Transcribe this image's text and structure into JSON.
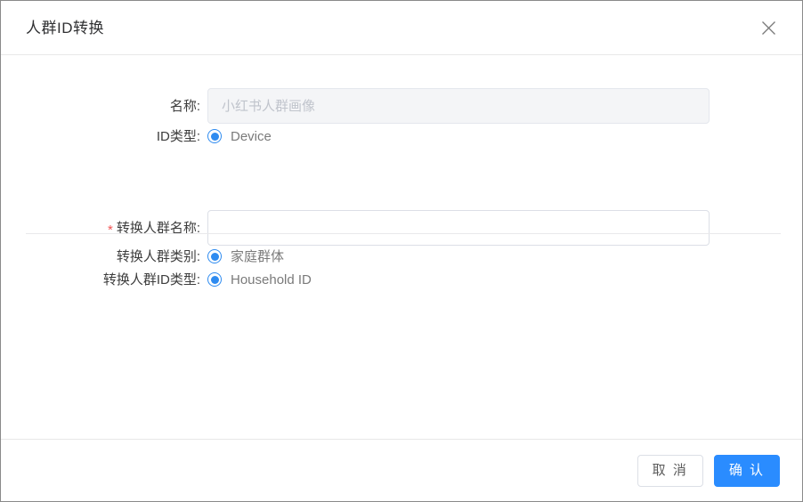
{
  "dialog": {
    "title": "人群ID转换",
    "close_icon": "close-icon"
  },
  "form": {
    "name_row": {
      "label": "名称:",
      "input_value": "",
      "input_placeholder": "小红书人群画像",
      "disabled": true
    },
    "id_type_row": {
      "label": "ID类型:",
      "options": [
        {
          "label": "Device",
          "selected": true
        }
      ]
    },
    "target_name_row": {
      "required_mark": "*",
      "label": "转换人群名称:",
      "input_value": "",
      "input_placeholder": ""
    },
    "target_category_row": {
      "label": "转换人群类别:",
      "options": [
        {
          "label": "家庭群体",
          "selected": true
        }
      ]
    },
    "target_id_type_row": {
      "label": "转换人群ID类型:",
      "options": [
        {
          "label": "Household ID",
          "selected": true
        }
      ]
    }
  },
  "footer": {
    "cancel_label": "取 消",
    "confirm_label": "确 认"
  },
  "colors": {
    "primary": "#2a8cff",
    "radio_blue": "#2e8bf0",
    "required_red": "#f25555",
    "border": "#dcdfe6",
    "disabled_bg": "#f4f5f7"
  }
}
